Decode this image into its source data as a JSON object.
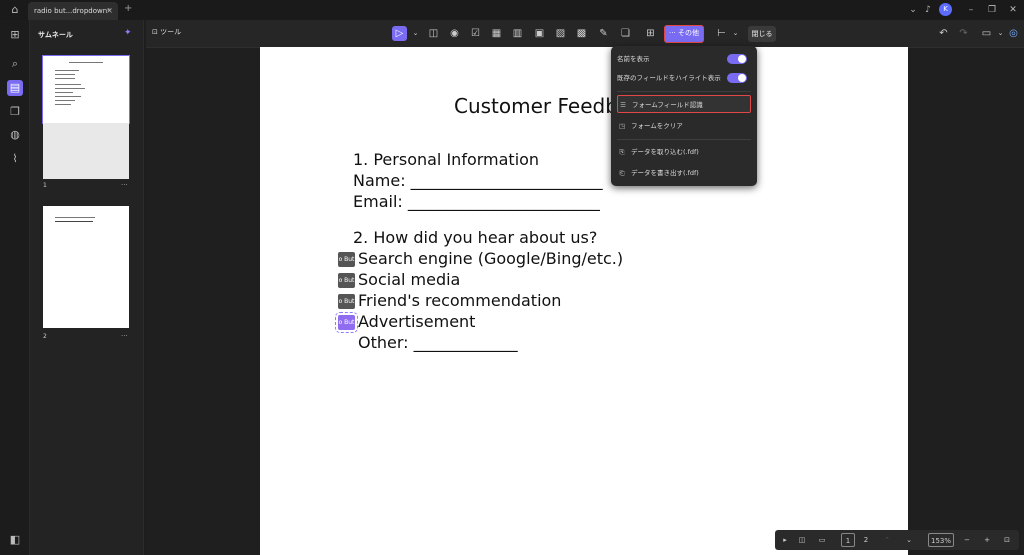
{
  "titlebar": {
    "tab_label": "radio but...dropdown*",
    "tab_close": "×",
    "add_tab": "+",
    "avatar": "K"
  },
  "sidebar": {
    "title": "サムネール",
    "pages": [
      {
        "number": "1",
        "more": "···"
      },
      {
        "number": "2",
        "more": "···"
      }
    ]
  },
  "toolbar": {
    "tools_label": "ツール",
    "more_label": "··· その他",
    "close_label": "閉じる"
  },
  "document": {
    "title": "Customer Feedb",
    "s1_heading": "1. Personal Information",
    "name_field": "Name: ________________________",
    "email_field": "Email: ________________________",
    "s2_heading": "2. How did you hear about us?",
    "radio_label": "o But",
    "options": [
      "Search engine (Google/Bing/etc.)",
      "Social media",
      "Friend's recommendation",
      "Advertisement"
    ],
    "other_field": "Other: _____________"
  },
  "menu": {
    "items": [
      {
        "label": "名前を表示"
      },
      {
        "label": "既存のフィールドをハイライト表示"
      },
      {
        "label": "フォームフィールド認識"
      },
      {
        "label": "フォームをクリア"
      },
      {
        "label": "データを取り込む(.fdf)"
      },
      {
        "label": "データを書き出す(.fdf)"
      }
    ]
  },
  "pagebar": {
    "page_current": "1",
    "page_total": "2",
    "zoom": "153%",
    "minus": "−",
    "plus": "+"
  },
  "colors": {
    "accent": "#7a6cf2",
    "highlight_border": "#e04848"
  }
}
